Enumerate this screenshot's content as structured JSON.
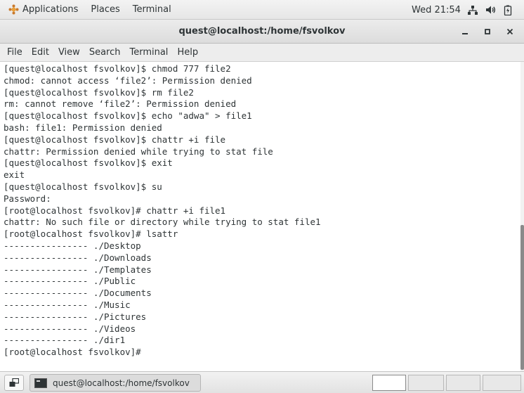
{
  "top_panel": {
    "applications": "Applications",
    "places": "Places",
    "terminal": "Terminal",
    "clock": "Wed 21:54",
    "tray_icons": [
      "network-icon",
      "volume-icon",
      "battery-icon"
    ]
  },
  "window": {
    "title": "quest@localhost:/home/fsvolkov",
    "controls": {
      "minimize": "_",
      "maximize": "▫",
      "close": "×"
    }
  },
  "menubar": {
    "items": [
      "File",
      "Edit",
      "View",
      "Search",
      "Terminal",
      "Help"
    ]
  },
  "terminal": {
    "lines": [
      "[quest@localhost fsvolkov]$ chmod 777 file2",
      "chmod: cannot access ‘file2’: Permission denied",
      "[quest@localhost fsvolkov]$ rm file2",
      "rm: cannot remove ‘file2’: Permission denied",
      "[quest@localhost fsvolkov]$ echo \"adwa\" > file1",
      "bash: file1: Permission denied",
      "[quest@localhost fsvolkov]$ chattr +i file",
      "chattr: Permission denied while trying to stat file",
      "[quest@localhost fsvolkov]$ exit",
      "exit",
      "[quest@localhost fsvolkov]$ su",
      "Password:",
      "[root@localhost fsvolkov]# chattr +i file1",
      "chattr: No such file or directory while trying to stat file1",
      "[root@localhost fsvolkov]# lsattr",
      "---------------- ./Desktop",
      "---------------- ./Downloads",
      "---------------- ./Templates",
      "---------------- ./Public",
      "---------------- ./Documents",
      "---------------- ./Music",
      "---------------- ./Pictures",
      "---------------- ./Videos",
      "---------------- ./dir1",
      "[root@localhost fsvolkov]# "
    ]
  },
  "taskbar": {
    "task_label": "quest@localhost:/home/fsvolkov",
    "workspaces": 4,
    "active_workspace": 1
  },
  "colors": {
    "panel_bg": "#e6e6e6",
    "terminal_bg": "#ffffff",
    "terminal_fg": "#2e3436"
  }
}
